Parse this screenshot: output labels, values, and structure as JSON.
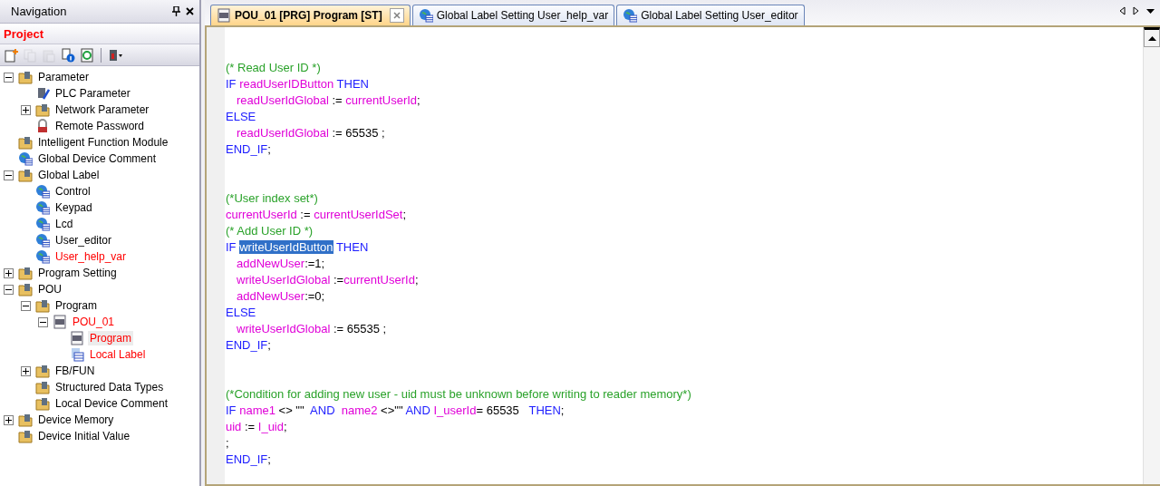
{
  "navigation": {
    "title": "Navigation",
    "project_label": "Project",
    "toolbar": [
      {
        "kind": "new",
        "disabled": false
      },
      {
        "kind": "copy",
        "disabled": true
      },
      {
        "kind": "paste",
        "disabled": true
      },
      {
        "kind": "info",
        "disabled": false
      },
      {
        "kind": "refresh",
        "disabled": false
      },
      {
        "kind": "device",
        "disabled": false
      }
    ],
    "tree": [
      {
        "label": "Parameter",
        "kind": "folder",
        "expanded": true,
        "red": false,
        "selected": false,
        "children": [
          {
            "label": "PLC Parameter",
            "kind": "plc",
            "red": false,
            "selected": false
          },
          {
            "label": "Network Parameter",
            "kind": "folder",
            "expanded": false,
            "red": false,
            "selected": false
          },
          {
            "label": "Remote Password",
            "kind": "lock",
            "red": false,
            "selected": false
          }
        ]
      },
      {
        "label": "Intelligent Function Module",
        "kind": "folder",
        "red": false,
        "selected": false
      },
      {
        "label": "Global Device Comment",
        "kind": "globe",
        "red": false,
        "selected": false
      },
      {
        "label": "Global Label",
        "kind": "folder",
        "expanded": true,
        "red": false,
        "selected": false,
        "children": [
          {
            "label": "Control",
            "kind": "globe",
            "red": false,
            "selected": false
          },
          {
            "label": "Keypad",
            "kind": "globe",
            "red": false,
            "selected": false
          },
          {
            "label": "Lcd",
            "kind": "globe",
            "red": false,
            "selected": false
          },
          {
            "label": "User_editor",
            "kind": "globe",
            "red": false,
            "selected": false
          },
          {
            "label": "User_help_var",
            "kind": "globe",
            "red": true,
            "selected": false
          }
        ]
      },
      {
        "label": "Program Setting",
        "kind": "folder",
        "expanded": false,
        "red": false,
        "selected": false
      },
      {
        "label": "POU",
        "kind": "folder",
        "expanded": true,
        "red": false,
        "selected": false,
        "children": [
          {
            "label": "Program",
            "kind": "folder",
            "expanded": true,
            "red": false,
            "selected": false,
            "children": [
              {
                "label": "POU_01",
                "kind": "st",
                "expanded": true,
                "red": true,
                "selected": false,
                "children": [
                  {
                    "label": "Program",
                    "kind": "st",
                    "red": true,
                    "selected": true
                  },
                  {
                    "label": "Local Label",
                    "kind": "table",
                    "red": true,
                    "selected": false
                  }
                ]
              }
            ]
          },
          {
            "label": "FB/FUN",
            "kind": "folder",
            "expanded": false,
            "red": false,
            "selected": false
          },
          {
            "label": "Structured Data Types",
            "kind": "folder",
            "red": false,
            "selected": false
          },
          {
            "label": "Local Device Comment",
            "kind": "folder",
            "red": false,
            "selected": false
          }
        ]
      },
      {
        "label": "Device Memory",
        "kind": "folder",
        "expanded": false,
        "red": false,
        "selected": false
      },
      {
        "label": "Device Initial Value",
        "kind": "folder",
        "red": false,
        "selected": false
      }
    ]
  },
  "tabs": [
    {
      "label": "POU_01 [PRG] Program [ST]",
      "kind": "st",
      "selected": true
    },
    {
      "label": "Global Label Setting User_help_var",
      "kind": "globe",
      "selected": false
    },
    {
      "label": "Global Label Setting User_editor",
      "kind": "globe",
      "selected": false
    }
  ],
  "code_blocks": [
    [
      {
        "indent": false,
        "tokens": [
          {
            "kind": "comment",
            "text": "(* Read User ID *)"
          }
        ]
      },
      {
        "indent": false,
        "tokens": [
          {
            "kind": "keyword",
            "text": "IF "
          },
          {
            "kind": "ident",
            "text": "readUserIDButton"
          },
          {
            "kind": "keyword",
            "text": " THEN"
          }
        ]
      },
      {
        "indent": true,
        "tokens": [
          {
            "kind": "ident",
            "text": "readUserIdGlobal"
          },
          {
            "kind": "plain",
            "text": " := "
          },
          {
            "kind": "ident",
            "text": "currentUserId"
          },
          {
            "kind": "plain",
            "text": ";"
          }
        ]
      },
      {
        "indent": false,
        "tokens": [
          {
            "kind": "keyword",
            "text": "ELSE"
          }
        ]
      },
      {
        "indent": true,
        "tokens": [
          {
            "kind": "ident",
            "text": "readUserIdGlobal"
          },
          {
            "kind": "plain",
            "text": " := 65535 ;"
          }
        ]
      },
      {
        "indent": false,
        "tokens": [
          {
            "kind": "keyword",
            "text": "END_IF"
          },
          {
            "kind": "plain",
            "text": ";"
          }
        ]
      }
    ],
    [
      {
        "indent": false,
        "tokens": [
          {
            "kind": "comment",
            "text": "(*User index set*)"
          }
        ]
      },
      {
        "indent": false,
        "tokens": [
          {
            "kind": "ident",
            "text": "currentUserId"
          },
          {
            "kind": "plain",
            "text": " := "
          },
          {
            "kind": "ident",
            "text": "currentUserIdSet"
          },
          {
            "kind": "plain",
            "text": ";"
          }
        ]
      },
      {
        "indent": false,
        "tokens": [
          {
            "kind": "comment",
            "text": "(* Add User ID *)"
          }
        ]
      },
      {
        "indent": false,
        "tokens": [
          {
            "kind": "keyword",
            "text": "IF "
          },
          {
            "kind": "selection",
            "text": "writeUserIdButton"
          },
          {
            "kind": "keyword",
            "text": " THEN"
          }
        ]
      },
      {
        "indent": true,
        "tokens": [
          {
            "kind": "ident",
            "text": "addNewUser"
          },
          {
            "kind": "plain",
            "text": ":=1;"
          }
        ]
      },
      {
        "indent": true,
        "tokens": [
          {
            "kind": "ident",
            "text": "writeUserIdGlobal"
          },
          {
            "kind": "plain",
            "text": " :="
          },
          {
            "kind": "ident",
            "text": "currentUserId"
          },
          {
            "kind": "plain",
            "text": ";"
          }
        ]
      },
      {
        "indent": true,
        "tokens": [
          {
            "kind": "ident",
            "text": "addNewUser"
          },
          {
            "kind": "plain",
            "text": ":=0;"
          }
        ]
      },
      {
        "indent": false,
        "tokens": [
          {
            "kind": "keyword",
            "text": "ELSE"
          }
        ]
      },
      {
        "indent": true,
        "tokens": [
          {
            "kind": "ident",
            "text": "writeUserIdGlobal"
          },
          {
            "kind": "plain",
            "text": " := 65535 ;"
          }
        ]
      },
      {
        "indent": false,
        "tokens": [
          {
            "kind": "keyword",
            "text": "END_IF"
          },
          {
            "kind": "plain",
            "text": ";"
          }
        ]
      }
    ],
    [
      {
        "indent": false,
        "tokens": [
          {
            "kind": "comment",
            "text": "(*Condition for adding new user - uid must be unknown before writing to reader memory*)"
          }
        ]
      },
      {
        "indent": false,
        "tokens": [
          {
            "kind": "keyword",
            "text": "IF "
          },
          {
            "kind": "ident",
            "text": "name1"
          },
          {
            "kind": "plain",
            "text": " <> \"\"  "
          },
          {
            "kind": "keyword",
            "text": "AND  "
          },
          {
            "kind": "ident",
            "text": "name2"
          },
          {
            "kind": "plain",
            "text": " <>\"\" "
          },
          {
            "kind": "keyword",
            "text": "AND "
          },
          {
            "kind": "ident",
            "text": "I_userId"
          },
          {
            "kind": "plain",
            "text": "= 65535   "
          },
          {
            "kind": "keyword",
            "text": "THEN"
          },
          {
            "kind": "plain",
            "text": ";"
          }
        ]
      },
      {
        "indent": false,
        "tokens": [
          {
            "kind": "ident",
            "text": "uid"
          },
          {
            "kind": "plain",
            "text": " := "
          },
          {
            "kind": "ident",
            "text": "I_uid"
          },
          {
            "kind": "plain",
            "text": ";"
          }
        ]
      },
      {
        "indent": false,
        "tokens": [
          {
            "kind": "plain",
            "text": ";"
          }
        ]
      },
      {
        "indent": false,
        "tokens": [
          {
            "kind": "keyword",
            "text": "END_IF"
          },
          {
            "kind": "plain",
            "text": ";"
          }
        ]
      }
    ]
  ]
}
